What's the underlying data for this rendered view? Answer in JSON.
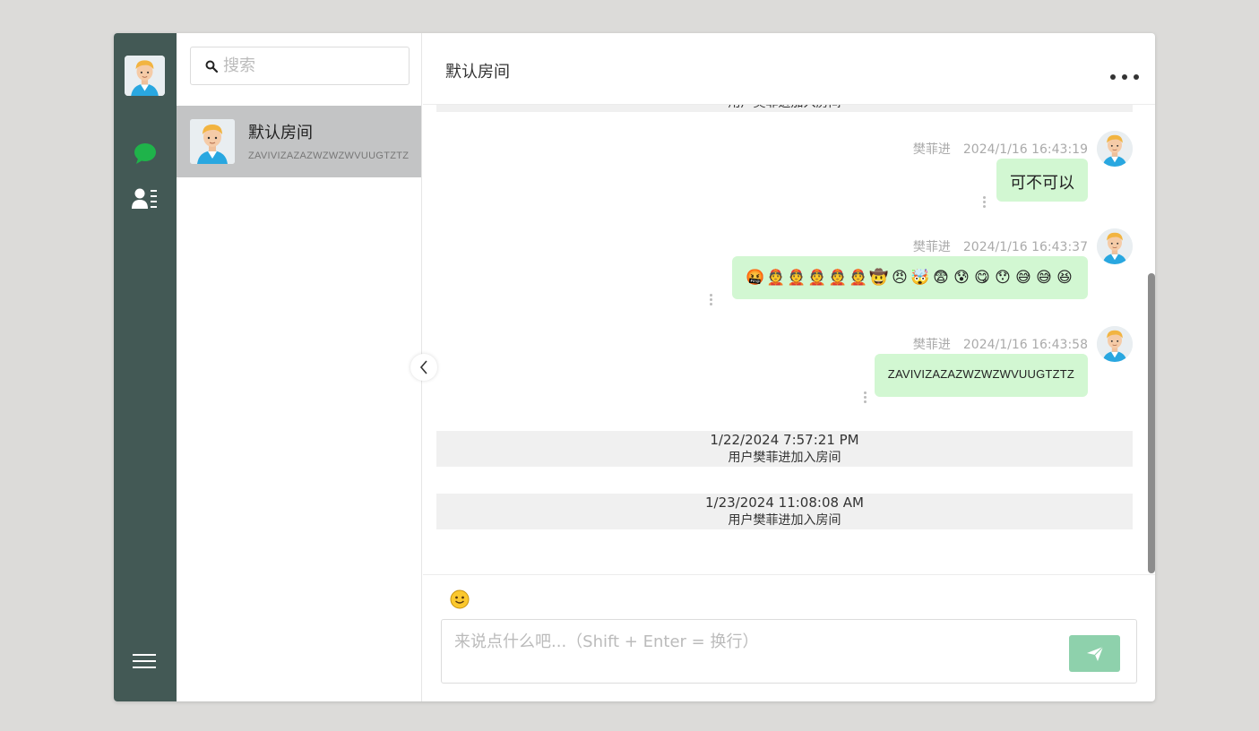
{
  "search": {
    "placeholder": "搜索"
  },
  "rooms": [
    {
      "name": "默认房间",
      "preview": "ZAVIVIZAZAZWZWZWVUUGTZTZ"
    }
  ],
  "chat": {
    "title": "默认房间",
    "top_system_text": "用户樊菲进加入房间",
    "messages": [
      {
        "sender": "樊菲进",
        "time": "2024/1/16 16:43:19",
        "text": "可不可以"
      },
      {
        "sender": "樊菲进",
        "time": "2024/1/16 16:43:37",
        "emojis": [
          "🤬",
          "👲",
          "👲",
          "👲",
          "👲",
          "👲",
          "🤠",
          "😠",
          "🤯",
          "😨",
          "😰",
          "😋",
          "😯",
          "😅",
          "😅",
          "😆"
        ]
      },
      {
        "sender": "樊菲进",
        "time": "2024/1/16 16:43:58",
        "text": "ZAVIVIZAZAZWZWZWVUUGTZTZ"
      }
    ],
    "system_messages": [
      {
        "time": "1/22/2024 7:57:21 PM",
        "text": "用户樊菲进加入房间"
      },
      {
        "time": "1/23/2024 11:08:08 AM",
        "text": "用户樊菲进加入房间"
      }
    ]
  },
  "composer": {
    "placeholder": "来说点什么吧...（Shift + Enter = 换行）"
  },
  "colors": {
    "rail": "#435955",
    "active_room": "#c3c4c5",
    "bubble": "#d2f7d2",
    "send_button": "#8ed1ac",
    "chat_icon": "#1fb34a"
  },
  "icons": [
    "chat-icon",
    "contacts-icon",
    "menu-icon",
    "search-icon",
    "more-icon",
    "collapse-chevron-icon",
    "emoji-icon",
    "send-icon"
  ]
}
